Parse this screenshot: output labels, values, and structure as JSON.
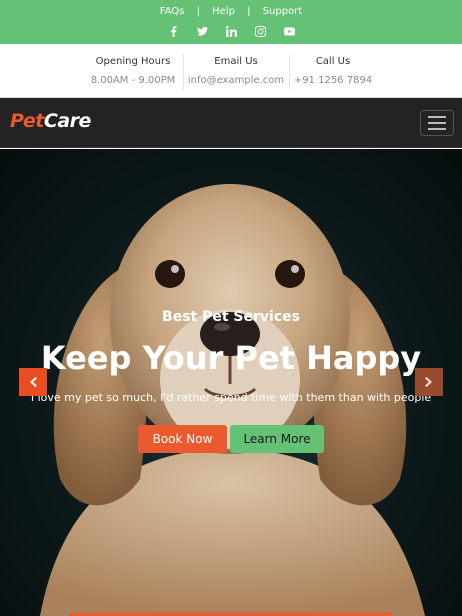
{
  "topbar": {
    "links": [
      "FAQs",
      "Help",
      "Support"
    ],
    "separator": "|",
    "socials": [
      "facebook-icon",
      "twitter-icon",
      "linkedin-icon",
      "instagram-icon",
      "youtube-icon"
    ]
  },
  "info": [
    {
      "title": "Opening Hours",
      "value": "8.00AM - 9.00PM"
    },
    {
      "title": "Email Us",
      "value": "info@example.com"
    },
    {
      "title": "Call Us",
      "value": "+91 1256 7894"
    }
  ],
  "navbar": {
    "brand_pet": "Pet",
    "brand_care": "Care"
  },
  "hero": {
    "subtitle": "Best Pet Services",
    "title": "Keep Your Pet Happy",
    "quote": "\"I love my pet so much, I'd rather spend time with them than with people\"",
    "book_label": "Book Now",
    "learn_label": "Learn More"
  },
  "colors": {
    "green": "#65c174",
    "orange": "#ea5a2e",
    "dark": "#232323"
  }
}
